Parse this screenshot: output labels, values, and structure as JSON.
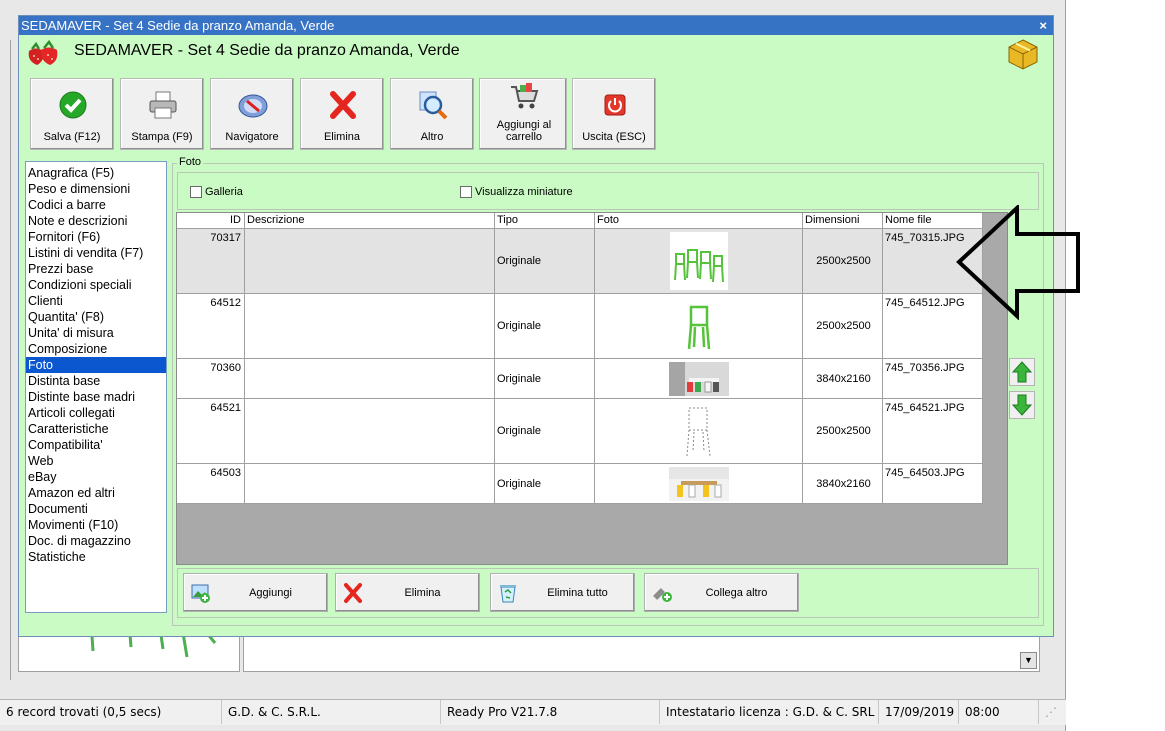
{
  "dialog": {
    "window_title": "SEDAMAVER - Set 4 Sedie da pranzo Amanda, Verde",
    "header_title": "SEDAMAVER - Set 4 Sedie da pranzo Amanda, Verde",
    "close_glyph": "×"
  },
  "toolbar": {
    "buttons": [
      {
        "label": "Salva (F12)",
        "icon": "check-icon"
      },
      {
        "label": "Stampa (F9)",
        "icon": "printer-icon"
      },
      {
        "label": "Navigatore",
        "icon": "compass-icon"
      },
      {
        "label": "Elimina",
        "icon": "red-x-icon"
      },
      {
        "label": "Altro",
        "icon": "magnifier-icon"
      },
      {
        "label": "Aggiungi al carrello",
        "icon": "cart-icon"
      },
      {
        "label": "Uscita (ESC)",
        "icon": "power-icon"
      }
    ]
  },
  "nav": {
    "items": [
      "Anagrafica (F5)",
      "Peso e dimensioni",
      "Codici a barre",
      "Note e descrizioni",
      "Fornitori (F6)",
      "Listini di vendita (F7)",
      "Prezzi base",
      "Condizioni speciali",
      "Clienti",
      "Quantita' (F8)",
      "Unita' di misura",
      "Composizione",
      "Foto",
      "Distinta base",
      "Distinte base madri",
      "Articoli collegati",
      "Caratteristiche",
      "Compatibilita'",
      "Web",
      "eBay",
      "Amazon ed altri",
      "Documenti",
      "Movimenti (F10)",
      "Doc. di magazzino",
      "Statistiche"
    ],
    "selected": "Foto"
  },
  "foto": {
    "group_label": "Foto",
    "galleria_label": "Galleria",
    "galleria_checked": false,
    "miniature_label": "Visualizza miniature",
    "miniature_checked": false
  },
  "grid": {
    "columns": [
      "ID",
      "Descrizione",
      "Tipo",
      "Foto",
      "Dimensioni",
      "Nome file"
    ],
    "rows": [
      {
        "id": "70317",
        "descrizione": "",
        "tipo": "Originale",
        "dimensioni": "2500x2500",
        "nome_file": "745_70315.JPG"
      },
      {
        "id": "64512",
        "descrizione": "",
        "tipo": "Originale",
        "dimensioni": "2500x2500",
        "nome_file": "745_64512.JPG"
      },
      {
        "id": "70360",
        "descrizione": "",
        "tipo": "Originale",
        "dimensioni": "3840x2160",
        "nome_file": "745_70356.JPG"
      },
      {
        "id": "64521",
        "descrizione": "",
        "tipo": "Originale",
        "dimensioni": "2500x2500",
        "nome_file": "745_64521.JPG"
      },
      {
        "id": "64503",
        "descrizione": "",
        "tipo": "Originale",
        "dimensioni": "3840x2160",
        "nome_file": "745_64503.JPG"
      }
    ]
  },
  "bottom_buttons": [
    {
      "label": "Aggiungi",
      "icon": "add-image-icon"
    },
    {
      "label": "Elimina",
      "icon": "red-x-icon"
    },
    {
      "label": "Elimina tutto",
      "icon": "recycle-bin-icon"
    },
    {
      "label": "Collega altro",
      "icon": "link-add-icon"
    }
  ],
  "statusbar": {
    "records": "6 record trovati (0,5 secs)",
    "company": "G.D. & C. S.R.L.",
    "version": "Ready Pro V21.7.8",
    "license": "Intestatario licenza : G.D. & C. SRL",
    "date": "17/09/2019",
    "time": "08:00"
  },
  "colors": {
    "dialog_bg": "#cbfbc5",
    "titlebar": "#3773c4",
    "selection": "#0a57d0"
  }
}
